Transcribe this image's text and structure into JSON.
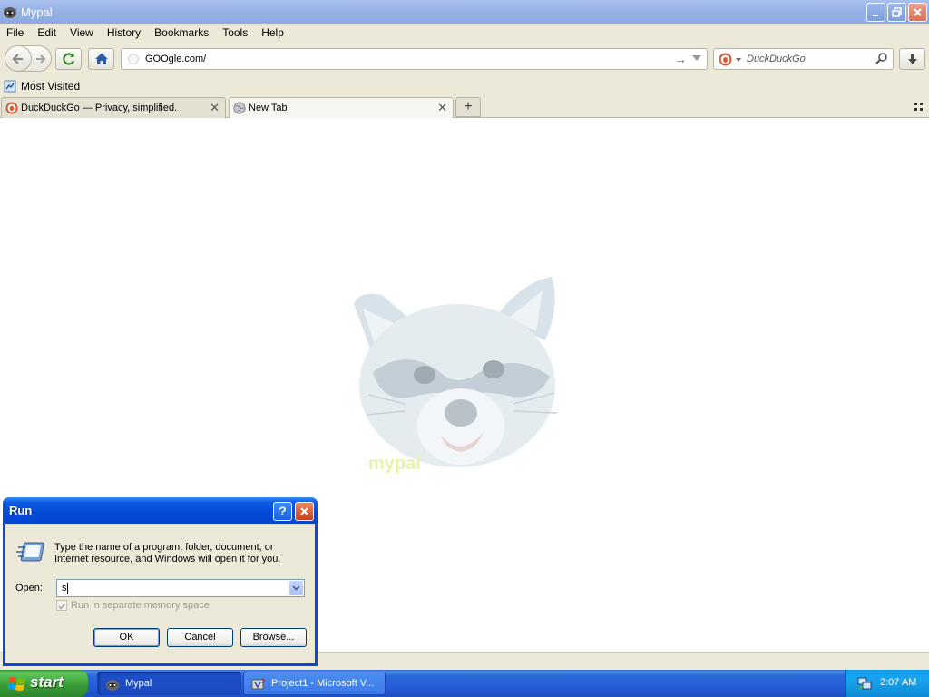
{
  "window": {
    "title": "Mypal",
    "menu": [
      "File",
      "Edit",
      "View",
      "History",
      "Bookmarks",
      "Tools",
      "Help"
    ]
  },
  "nav": {
    "url": "GOOgle.com/",
    "search_placeholder": "DuckDuckGo"
  },
  "bookmarks": {
    "most_visited": "Most Visited"
  },
  "tabs": [
    {
      "label": "DuckDuckGo — Privacy, simplified.",
      "icon": "duckduckgo-icon",
      "active": false
    },
    {
      "label": "New Tab",
      "icon": "globe-icon",
      "active": true
    }
  ],
  "content": {
    "mascot": "raccoon-logo",
    "mascot_text": "mypal"
  },
  "run_dialog": {
    "title": "Run",
    "description": "Type the name of a program, folder, document, or Internet resource, and Windows will open it for you.",
    "open_label": "Open:",
    "open_value": "s",
    "checkbox_label": "Run in separate memory space",
    "checkbox_checked": true,
    "ok": "OK",
    "cancel": "Cancel",
    "browse": "Browse..."
  },
  "taskbar": {
    "start": "start",
    "items": [
      {
        "label": "Mypal",
        "active": true
      },
      {
        "label": "Project1 - Microsoft V...",
        "active": false
      }
    ],
    "clock": "2:07 AM"
  },
  "colors": {
    "titlebar": "#97b1e6",
    "chrome": "#ece9d8",
    "xp_blue": "#0a48d8",
    "start_green": "#3c9a3a"
  }
}
